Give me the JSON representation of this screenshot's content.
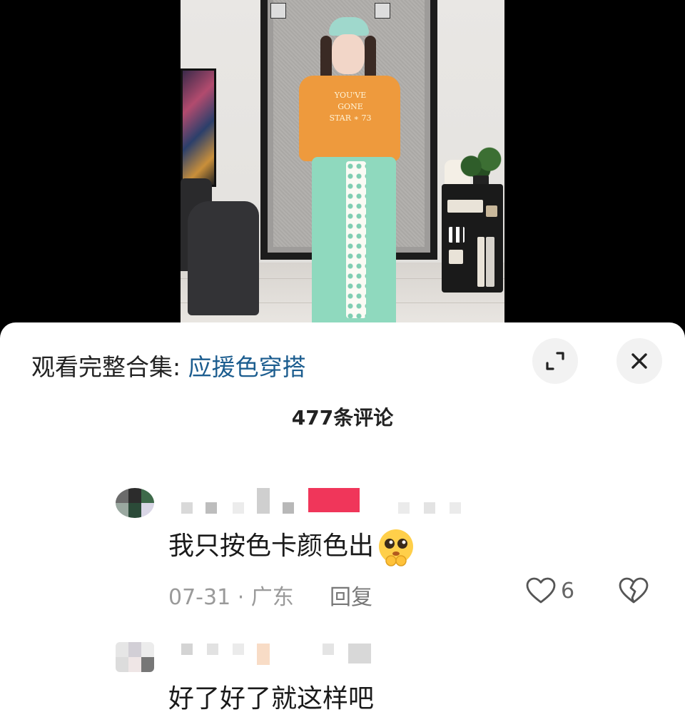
{
  "collection": {
    "prefix": "观看完整合集: ",
    "link": "应援色穿搭"
  },
  "comments_title": "477条评论",
  "comments": [
    {
      "text": "我只按色卡颜色出",
      "emoji": "pleading-face-emoji",
      "date_location": "07-31 · 广东",
      "reply_label": "回复",
      "likes": "6"
    },
    {
      "text": "好了好了就这样吧"
    }
  ],
  "video": {
    "shirt_print": "YOU'VE GONE STAR ∗ 73"
  },
  "colors": {
    "link": "#1c5d8f",
    "username_tag": "#f0365a",
    "muted": "#9a9a9a"
  }
}
